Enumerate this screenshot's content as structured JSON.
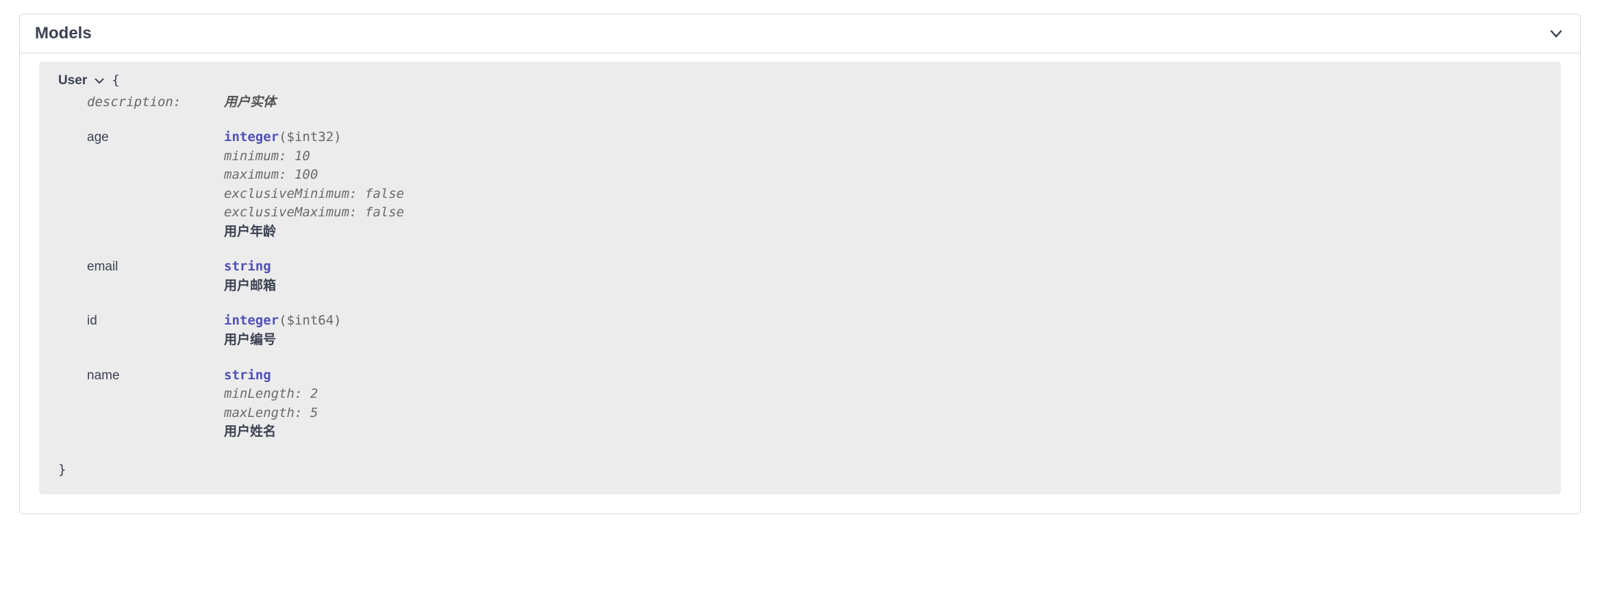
{
  "section": {
    "title": "Models"
  },
  "model": {
    "name": "User",
    "brace_open": "{",
    "brace_close": "}",
    "description_label": "description:",
    "description_value": "用户实体",
    "props": {
      "age": {
        "name": "age",
        "type": "integer",
        "format": "($int32)",
        "minimum": "minimum: 10",
        "maximum": "maximum: 100",
        "exclusiveMinimum": "exclusiveMinimum: false",
        "exclusiveMaximum": "exclusiveMaximum: false",
        "desc": "用户年龄"
      },
      "email": {
        "name": "email",
        "type": "string",
        "desc": "用户邮箱"
      },
      "id": {
        "name": "id",
        "type": "integer",
        "format": "($int64)",
        "desc": "用户编号"
      },
      "nameProp": {
        "name": "name",
        "type": "string",
        "minLength": "minLength: 2",
        "maxLength": "maxLength: 5",
        "desc": "用户姓名"
      }
    }
  }
}
